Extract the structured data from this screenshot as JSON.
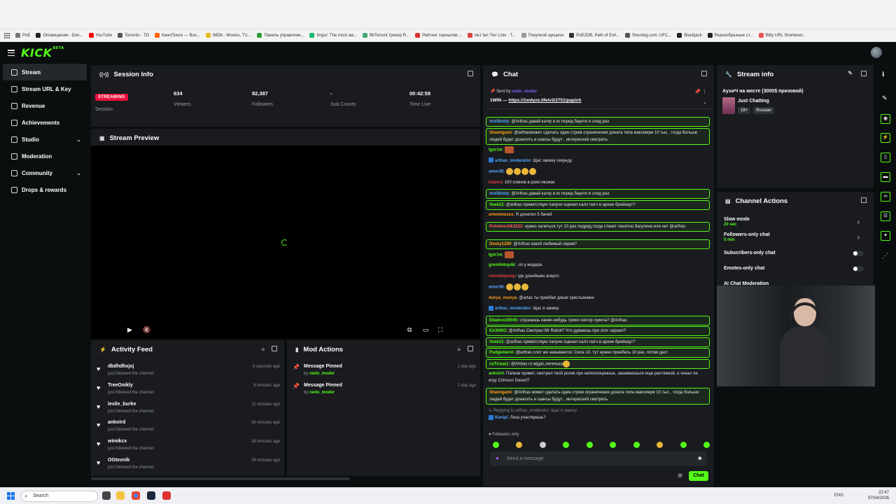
{
  "bookmarks": [
    {
      "label": "PoE",
      "color": "#777"
    },
    {
      "label": "Оповещения - Don...",
      "color": "#222"
    },
    {
      "label": "YouTube",
      "color": "#ff0000"
    },
    {
      "label": "Torrents - TD",
      "color": "#555"
    },
    {
      "label": "КиноПоиск — Все...",
      "color": "#f60"
    },
    {
      "label": "IMDb - Movies, TV,...",
      "color": "#e6b91e"
    },
    {
      "label": "Панель управлени...",
      "color": "#2d9e3a"
    },
    {
      "label": "Imgur: The most aw...",
      "color": "#1bb76e"
    },
    {
      "label": "BitTorrent трекер R...",
      "color": "#4a7"
    },
    {
      "label": "Рейтинг сериалов:...",
      "color": "#d33"
    },
    {
      "label": "№1 fan Tier Lists - T...",
      "color": "#d44"
    },
    {
      "label": "Покупной аукцион",
      "color": "#999"
    },
    {
      "label": "PoE2DB, Path of Exil...",
      "color": "#333"
    },
    {
      "label": "Sherdog.com: UFC...",
      "color": "#555"
    },
    {
      "label": "Blackjack",
      "color": "#222"
    },
    {
      "label": "Разнообразные ст...",
      "color": "#222"
    },
    {
      "label": "Bitly URL Shortener...",
      "color": "#e55"
    }
  ],
  "logo": {
    "text": "KICK",
    "sup": "BETA"
  },
  "sidebar": {
    "items": [
      {
        "label": "Stream",
        "active": true
      },
      {
        "label": "Stream URL & Key"
      },
      {
        "label": "Revenue"
      },
      {
        "label": "Achievements"
      },
      {
        "label": "Studio",
        "chevron": true
      },
      {
        "label": "Moderation"
      },
      {
        "label": "Community",
        "chevron": true
      },
      {
        "label": "Drops & rewards"
      }
    ]
  },
  "session": {
    "title": "Session Info",
    "badge": "STREAMING",
    "session_label": "Session",
    "stats": [
      {
        "value": "634",
        "label": "Viewers"
      },
      {
        "value": "82,387",
        "label": "Followers"
      },
      {
        "value": "-",
        "label": "Sub Counts"
      },
      {
        "value": "00:42:58",
        "label": "Time Live"
      }
    ]
  },
  "preview": {
    "title": "Stream Preview"
  },
  "activity": {
    "title": "Activity Feed",
    "items": [
      {
        "name": "dbdhdhxjxj",
        "sub": "just followed the channel",
        "time": "9 seconds ago"
      },
      {
        "name": "TreeOnikly",
        "sub": "just followed the channel",
        "time": "6 minutes ago"
      },
      {
        "name": "leslie_burke",
        "sub": "just followed the channel",
        "time": "11 minutes ago"
      },
      {
        "name": "ankoird",
        "sub": "just followed the channel",
        "time": "16 minutes ago"
      },
      {
        "name": "wimikcx",
        "sub": "just followed the channel",
        "time": "28 minutes ago"
      },
      {
        "name": "OGtexnik",
        "sub": "just followed the channel",
        "time": "29 minutes ago"
      }
    ]
  },
  "mod_actions": {
    "title": "Mod Actions",
    "items": [
      {
        "name": "Message Pinned",
        "by": "by",
        "who": "nedo_moder",
        "time": "1 day ago"
      },
      {
        "name": "Message Pinned",
        "by": "by",
        "who": "nedo_moder",
        "time": "1 day ago"
      }
    ]
  },
  "chat": {
    "title": "Chat",
    "pinned": {
      "sent_by": "Sent by",
      "sender": "nedo_moder",
      "msg_prefix": "1WIN — ",
      "link": "https://1wdyze.life/v3/2751/papich"
    },
    "messages": [
      {
        "user": "mix0body",
        "color": "#5aa6ff",
        "text": "@Arthas давай катку в кс перед баунти в след раз",
        "hl": true
      },
      {
        "user": "Shamigami",
        "color": "#ff9f1a",
        "text": "@arthasможет сделать один стрим ограничения доната типа максимум 10 тыс , тогда больше людей будет донатить и шансы будут , интересней смотреть.",
        "hl": true,
        "lines": 2
      },
      {
        "user": "Igor1w",
        "color": "#53fc18",
        "text": "",
        "emote": "r"
      },
      {
        "user": "arthas_moderator",
        "color": "#53a6ff",
        "text": "Щас закину секунду",
        "mod": true
      },
      {
        "user": "amor38",
        "color": "#5aa6ff",
        "text": "",
        "emotes": 4
      },
      {
        "user": "klainra",
        "color": "#e83b3b",
        "text": "100 спинов в роял иксмас"
      },
      {
        "user": "mix0body",
        "color": "#5aa6ff",
        "text": "@Arthas давай катку в кс перед баунти в след раз",
        "hl": true
      },
      {
        "user": "Voek22",
        "color": "#53fc18",
        "text": "@arthas приветствую папучи оценил калл патч в арене брейкаут?",
        "hl": true
      },
      {
        "user": "artemiousss",
        "color": "#ff9f1a",
        "text": "Я донатил 5 бачей"
      },
      {
        "user": "Polotenchik3222",
        "color": "#ff5c5c",
        "text": "нужно залиться тут 10 раз подряд,тогда станет понятно багулина или нет @arthas",
        "hl": true,
        "lines": 2
      },
      {
        "user": "Desky1289",
        "color": "#ff9f1a",
        "text": "@Arthas какой любимый сириж?",
        "hl": true
      },
      {
        "user": "Igor1w",
        "color": "#53fc18",
        "text": "",
        "emote": "r"
      },
      {
        "user": "gremlintop4k",
        "color": "#53fc18",
        "text": "-зп у модера"
      },
      {
        "user": "rolordisposip",
        "color": "#e83b3b",
        "text": "где донейшен алертс"
      },
      {
        "user": "amor38",
        "color": "#5aa6ff",
        "text": "",
        "emotes": 3
      },
      {
        "user": "4unya_munya",
        "color": "#ff9f1a",
        "text": "@artas ты проебал донат крестьянини"
      },
      {
        "user": "arthas_moderator",
        "color": "#53a6ff",
        "text": "Щас я закину",
        "mod": true
      },
      {
        "user": "Ebalovo20045",
        "color": "#53fc18",
        "text": "слушаешь какие-нибудь треки сектор пукича? @Arthas",
        "hl": true
      },
      {
        "user": "КАЗНКО",
        "color": "#53fc18",
        "text": "@Arthas Смотрел Mr Robot? Что думаешь про этот сериал?",
        "hl": true
      },
      {
        "user": "Voek22",
        "color": "#53fc18",
        "text": "@arthas приветствую папучи оценил калл патч в арене брейкаут?",
        "hl": true
      },
      {
        "user": "Pudgemerin",
        "color": "#53fc18",
        "text": "@arthas слот же называется: Сила 10, тут нужно проебать 10 раз, потом даст",
        "hl": true
      },
      {
        "user": "saTiraaa1",
        "color": "#53fc18",
        "text": "@Arthas го мідас,легенька",
        "hl": true,
        "emotes": 1
      },
      {
        "user": "ankoird",
        "color": "#53fc18",
        "text": "Папизи привет, смотрел твой ролик про неполноценных, занимаешься еще растяжкой, и чекал ли игру Crimson Desert?",
        "lines": 2
      },
      {
        "user": "Shamigami",
        "color": "#ff9f1a",
        "text": "@Arthas может сделать один стрим ограничения доната типа максимум 10 тыс , тогда больше людей будет донатить и шансы будут , интересней смотреть.",
        "hl": true,
        "lines": 2
      }
    ],
    "reply_hint": "Replying to arthas_moderator: Щас я закину",
    "last": {
      "user": "Kenipi",
      "text": "Лиза участвуешь?"
    },
    "followers_only": "Followers only",
    "placeholder": "Send a message",
    "send": "Chat"
  },
  "stream_info": {
    "title": "Stream info",
    "stream_title": "АухиЧ на месте (3000$ призовой)",
    "category": "Just Chatting",
    "tags": [
      "18+",
      "Russian"
    ]
  },
  "channel_actions": {
    "title": "Channel Actions",
    "items": [
      {
        "label": "Slow mode",
        "sub": "20 sec",
        "kind": "chevron"
      },
      {
        "label": "Followers-only chat",
        "sub": "5 min",
        "kind": "chevron"
      },
      {
        "label": "Subscribers-only chat",
        "kind": "toggle"
      },
      {
        "label": "Emotes-only chat",
        "kind": "toggle"
      },
      {
        "label": "AI Chat Moderation",
        "kind": "none"
      }
    ]
  },
  "taskbar": {
    "search": "Search",
    "lang": "ENG",
    "time": "22:47",
    "date": "07/04/2026"
  }
}
